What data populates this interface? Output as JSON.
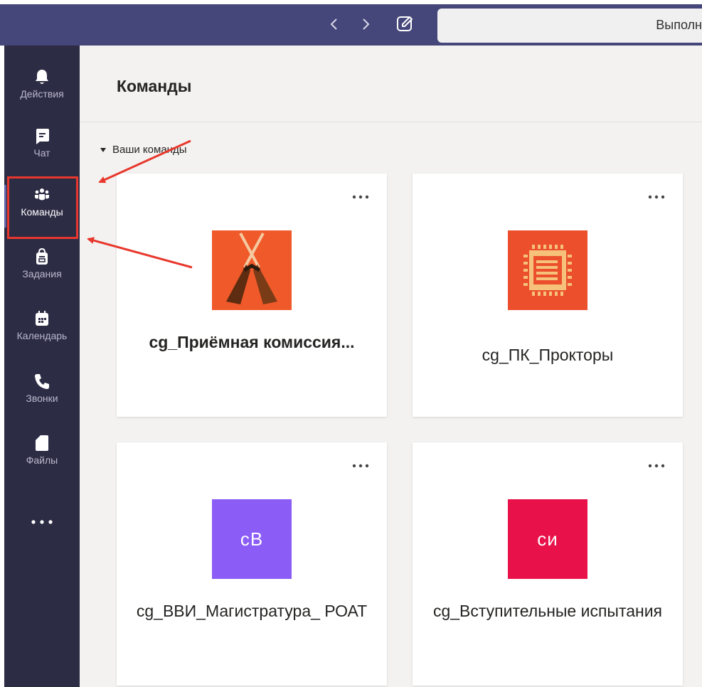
{
  "topbar": {
    "search_text": "Выполн"
  },
  "rail": {
    "items": [
      {
        "label": "Действия",
        "icon": "bell-icon"
      },
      {
        "label": "Чат",
        "icon": "chat-icon"
      },
      {
        "label": "Команды",
        "icon": "teams-icon",
        "active": true
      },
      {
        "label": "Задания",
        "icon": "assignments-icon"
      },
      {
        "label": "Календарь",
        "icon": "calendar-icon"
      },
      {
        "label": "Звонки",
        "icon": "phone-icon"
      },
      {
        "label": "Файлы",
        "icon": "file-icon"
      }
    ],
    "more_icon": "more-horizontal-icon"
  },
  "main": {
    "title": "Команды",
    "section_label": "Ваши команды",
    "teams": [
      {
        "name": "cg_Приёмная комиссия...",
        "avatar": "brooms-image",
        "avatar_color": "#f0592a",
        "bold": true
      },
      {
        "name": "cg_ПК_Прокторы",
        "avatar": "circuit-chip-image",
        "avatar_color": "#eb4f2c",
        "bold": false
      },
      {
        "name": "cg_ВВИ_Магистратура_ РОАТ",
        "initials": "сВ",
        "avatar_color": "#8b5cf6",
        "bold": false
      },
      {
        "name": "cg_Вступительные испытания",
        "initials": "си",
        "avatar_color": "#e8114a",
        "bold": false
      }
    ]
  },
  "colors": {
    "topbar": "#45467a",
    "rail": "#2d2c45",
    "annotation": "#e8372c"
  }
}
